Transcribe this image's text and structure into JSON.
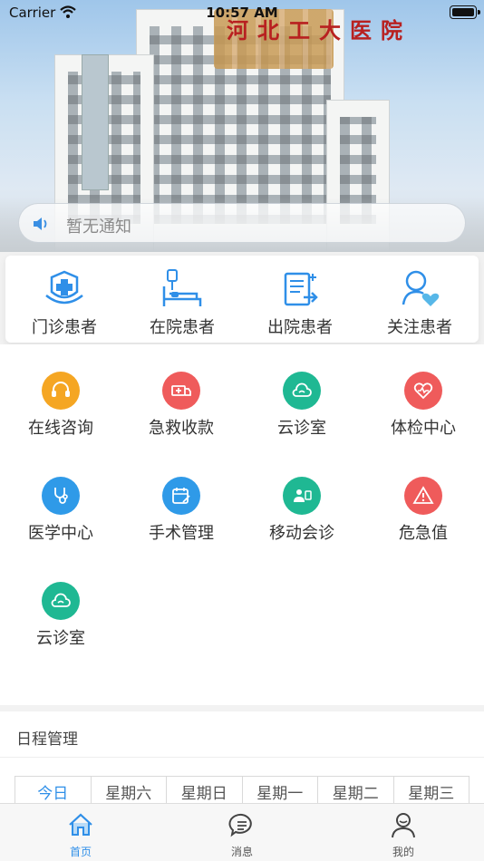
{
  "status": {
    "carrier": "Carrier",
    "time": "10:57 AM"
  },
  "hero": {
    "sign_text": "河北工大医院"
  },
  "notice": {
    "text": "暂无通知"
  },
  "patient_cards": [
    {
      "label": "门诊患者",
      "icon": "outpatient-icon"
    },
    {
      "label": "在院患者",
      "icon": "inpatient-bed-icon"
    },
    {
      "label": "出院患者",
      "icon": "discharge-icon"
    },
    {
      "label": "关注患者",
      "icon": "follow-heart-icon"
    }
  ],
  "features": [
    {
      "label": "在线咨询",
      "icon": "headset-icon",
      "color": "#f5a623"
    },
    {
      "label": "急救收款",
      "icon": "ambulance-icon",
      "color": "#ef5b5b"
    },
    {
      "label": "云诊室",
      "icon": "cloud-clinic-icon",
      "color": "#1fb893"
    },
    {
      "label": "体检中心",
      "icon": "heart-pulse-icon",
      "color": "#ef5b5b"
    },
    {
      "label": "医学中心",
      "icon": "stethoscope-icon",
      "color": "#2f9ae8"
    },
    {
      "label": "手术管理",
      "icon": "calendar-pen-icon",
      "color": "#2f9ae8"
    },
    {
      "label": "移动会诊",
      "icon": "video-consult-icon",
      "color": "#1fb893"
    },
    {
      "label": "危急值",
      "icon": "warning-icon",
      "color": "#ef5b5b"
    },
    {
      "label": "云诊室",
      "icon": "cloud-clinic-icon",
      "color": "#1fb893"
    }
  ],
  "schedule": {
    "title": "日程管理",
    "days": [
      "今日",
      "星期六",
      "星期日",
      "星期一",
      "星期二",
      "星期三"
    ]
  },
  "tabbar": [
    {
      "label": "首页",
      "icon": "home-icon"
    },
    {
      "label": "消息",
      "icon": "message-icon"
    },
    {
      "label": "我的",
      "icon": "profile-icon"
    }
  ]
}
